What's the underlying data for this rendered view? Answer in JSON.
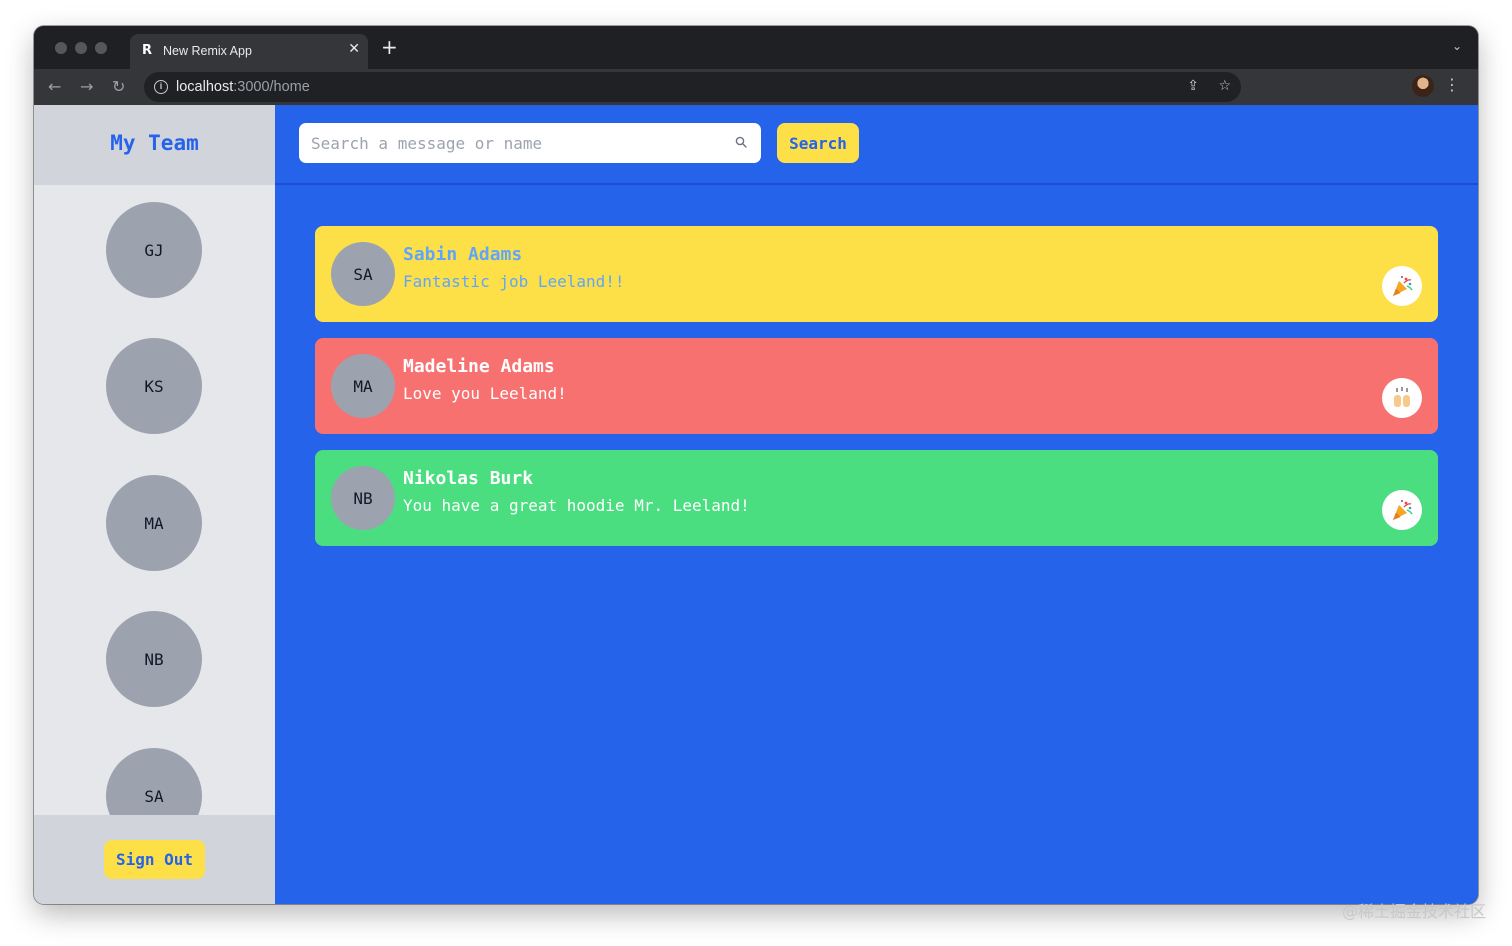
{
  "browser": {
    "tab_title": "New Remix App",
    "tab_favicon": "R",
    "close_glyph": "✕",
    "new_tab_glyph": "+",
    "tab_menu_glyph": "⌄",
    "back_glyph": "←",
    "forward_glyph": "→",
    "reload_glyph": "↻",
    "info_glyph": "i",
    "url_host": "localhost",
    "url_rest": ":3000/home",
    "share_glyph": "⇪",
    "star_glyph": "☆",
    "menu_glyph": "⋮"
  },
  "sidebar": {
    "title": "My Team",
    "members": [
      {
        "initials": "GJ"
      },
      {
        "initials": "KS"
      },
      {
        "initials": "MA"
      },
      {
        "initials": "NB"
      },
      {
        "initials": "SA"
      }
    ],
    "sign_out_label": "Sign Out"
  },
  "search": {
    "placeholder": "Search a message or name",
    "value": "",
    "button_label": "Search"
  },
  "kudos": [
    {
      "initials": "SA",
      "name": "Sabin Adams",
      "message": "Fantastic job Leeland!!",
      "emoji": "party-popper-icon",
      "bg": "#fde047",
      "text_color": "#60a5fa"
    },
    {
      "initials": "MA",
      "name": "Madeline Adams",
      "message": "Love you Leeland!",
      "emoji": "raising-hands-icon",
      "bg": "#f87171",
      "text_color": "#ffffff"
    },
    {
      "initials": "NB",
      "name": "Nikolas Burk",
      "message": "You have a great hoodie Mr. Leeland!",
      "emoji": "party-popper-icon",
      "bg": "#4ade80",
      "text_color": "#ffffff"
    }
  ],
  "watermark": "@稀土掘金技术社区",
  "colors": {
    "accent": "#2563eb",
    "button_yellow": "#fde047",
    "sidebar_bg": "#e5e7eb",
    "sidebar_header_bg": "#d1d5db",
    "avatar_gray": "#9ca3af"
  }
}
